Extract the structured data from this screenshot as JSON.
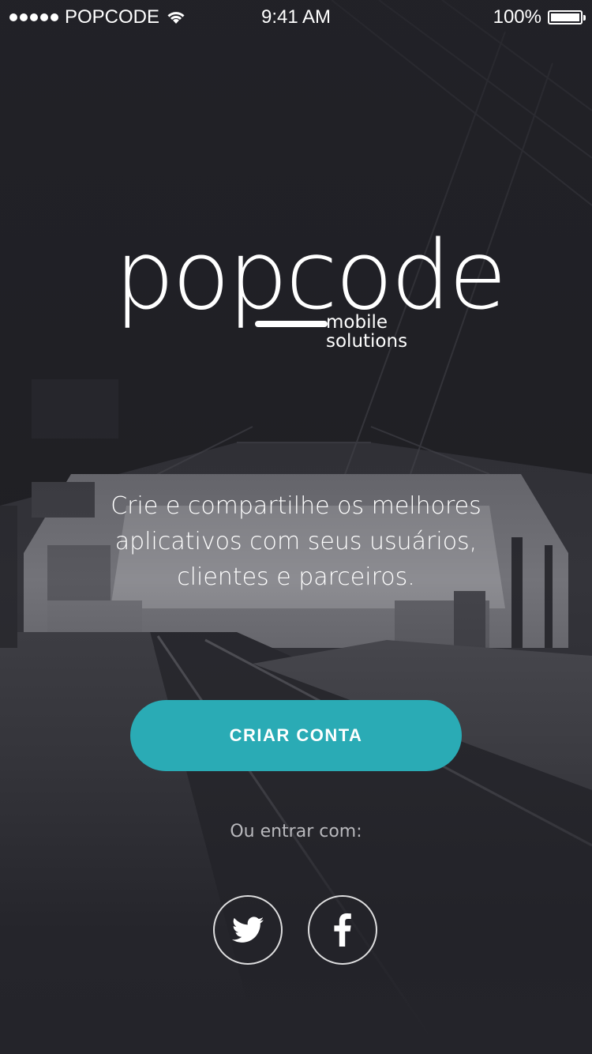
{
  "status_bar": {
    "carrier": "POPCODE",
    "time": "9:41 AM",
    "battery": "100%"
  },
  "logo": {
    "wordmark": "popcode",
    "subtitle_line1": "mobile",
    "subtitle_line2": "solutions"
  },
  "tagline": {
    "line1": "Crie e compartilhe os melhores",
    "line2": "aplicativos com seus usuários,",
    "line3": "clientes e parceiros."
  },
  "cta": {
    "label": "CRIAR CONTA"
  },
  "login": {
    "prompt": "Ou entrar com:",
    "twitter_icon": "twitter-icon",
    "facebook_icon": "facebook-icon"
  },
  "colors": {
    "accent": "#2aabb5",
    "background": "#2b2b30",
    "text": "#ffffff",
    "muted": "#b9b9bd"
  }
}
